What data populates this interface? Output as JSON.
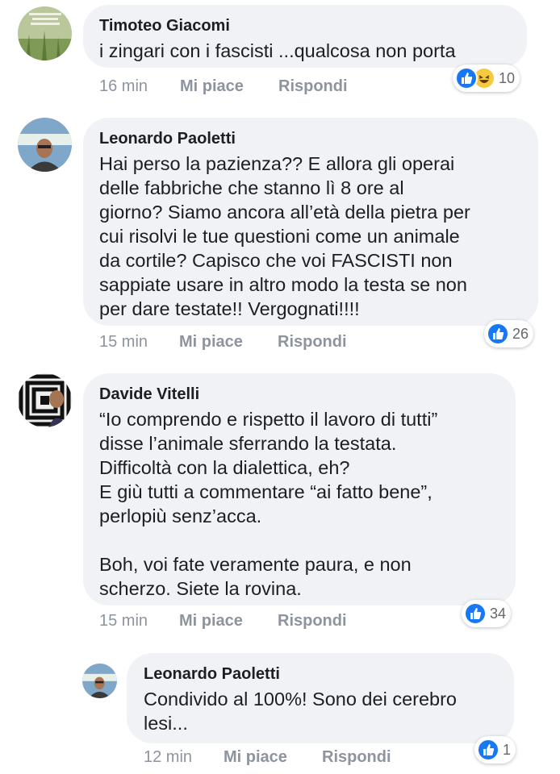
{
  "comments": [
    {
      "author": "Timoteo Giacomi",
      "text": "i zingari con i fascisti ...qualcosa non porta",
      "time": "16 min",
      "like_label": "Mi piace",
      "reply_label": "Rispondi",
      "reactions": [
        "like-icon",
        "haha-icon"
      ],
      "reaction_count": "10"
    },
    {
      "author": "Leonardo Paoletti",
      "text": "Hai perso la pazienza?? E allora gli operai\ndelle fabbriche che stanno lì 8 ore al\ngiorno? Siamo ancora all’età della pietra per\ncui risolvi le tue questioni come un animale\nda cortile? Capisco che voi FASCISTI non\nsappiate usare in altro modo la testa se non\nper dare testate!! Vergognati!!!!",
      "time": "15 min",
      "like_label": "Mi piace",
      "reply_label": "Rispondi",
      "reactions": [
        "like-icon"
      ],
      "reaction_count": "26"
    },
    {
      "author": "Davide Vitelli",
      "text": "“Io comprendo e rispetto il lavoro di tutti”\ndisse l’animale sferrando la testata.\nDifficoltà con la dialettica, eh?\nE giù tutti a commentare “ai fatto bene”,\nperlopiù senz’acca.\n\nBoh, voi fate veramente paura, e non\nscherzo. Siete la rovina.",
      "time": "15 min",
      "like_label": "Mi piace",
      "reply_label": "Rispondi",
      "reactions": [
        "like-icon"
      ],
      "reaction_count": "34"
    },
    {
      "author": "Leonardo Paoletti",
      "text": "Condivido al 100%! Sono dei cerebro\nlesi...",
      "time": "12 min",
      "like_label": "Mi piace",
      "reply_label": "Rispondi",
      "reactions": [
        "like-icon"
      ],
      "reaction_count": "1"
    }
  ],
  "colors": {
    "bubble": "#f0f2f5",
    "like_blue": "#1877f2",
    "haha_yellow": "#f7c93e",
    "meta_gray": "#8d949e"
  }
}
